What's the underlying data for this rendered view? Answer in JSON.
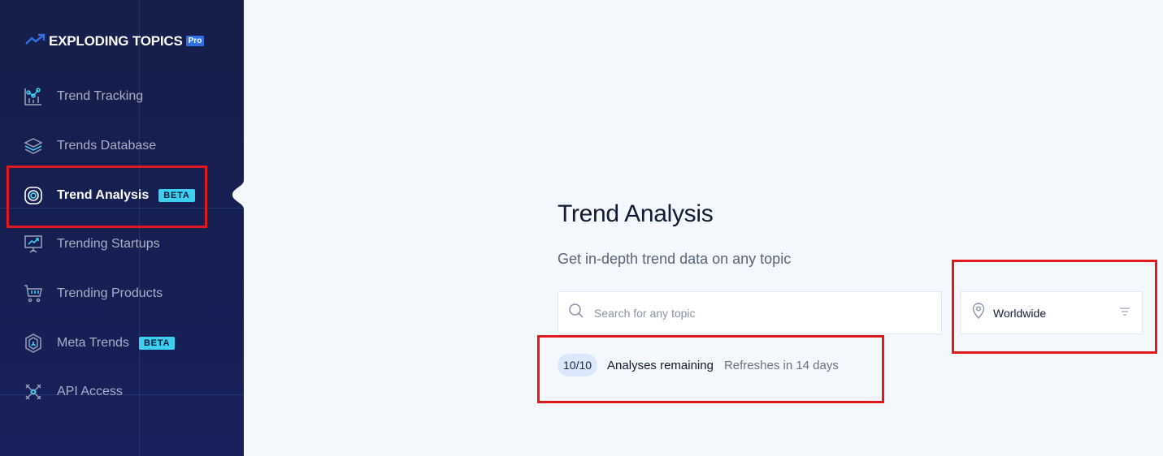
{
  "brand": {
    "name": "EXPLODING TOPICS",
    "tier_badge": "Pro",
    "accent": "#2f6fe0"
  },
  "sidebar": {
    "items": [
      {
        "label": "Trend Tracking",
        "icon": "trend-tracking-icon",
        "active": false,
        "badge": null
      },
      {
        "label": "Trends Database",
        "icon": "layers-icon",
        "active": false,
        "badge": null
      },
      {
        "label": "Trend Analysis",
        "icon": "target-icon",
        "active": true,
        "badge": "BETA"
      },
      {
        "label": "Trending Startups",
        "icon": "presentation-chart-icon",
        "active": false,
        "badge": null
      },
      {
        "label": "Trending Products",
        "icon": "shopping-cart-icon",
        "active": false,
        "badge": null
      },
      {
        "label": "Meta Trends",
        "icon": "hexagon-icon",
        "active": false,
        "badge": "BETA"
      },
      {
        "label": "API Access",
        "icon": "api-icon",
        "active": false,
        "badge": null
      }
    ]
  },
  "main": {
    "title": "Trend Analysis",
    "subtitle": "Get in-depth trend data on any topic",
    "search": {
      "placeholder": "Search for any topic",
      "value": ""
    },
    "location": {
      "selected": "Worldwide"
    },
    "quota": {
      "count": "10/10",
      "label": "Analyses remaining",
      "refresh": "Refreshes in 14 days"
    }
  },
  "colors": {
    "sidebar_bg": "#161e4a",
    "badge_beta": "#3ccfef",
    "highlight": "#e0191d",
    "page_bg": "#f4f8fc"
  }
}
